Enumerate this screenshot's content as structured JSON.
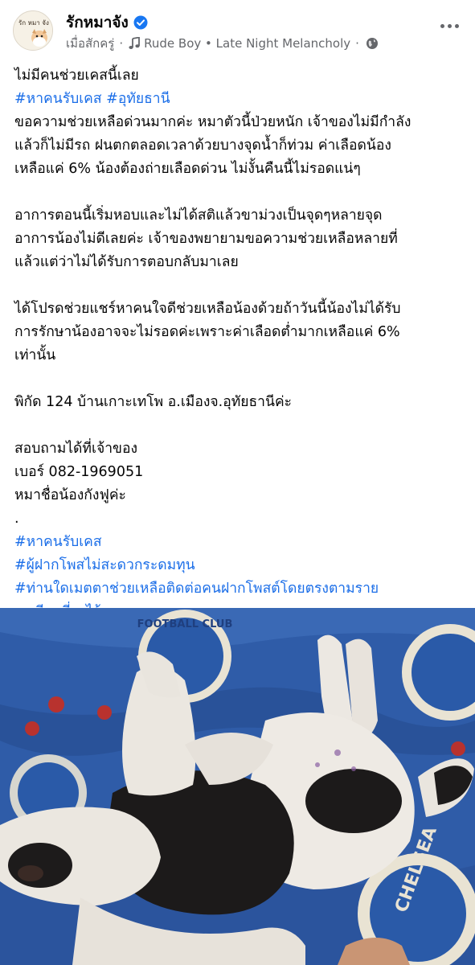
{
  "header": {
    "page_name": "รักหมาจัง",
    "timestamp": "เมื่อสักครู่",
    "music_track": "Rude Boy • Late Night Melancholy",
    "verified_icon": "verified-badge-icon",
    "music_icon": "music-note-icon",
    "audience_icon": "globe-icon",
    "more_icon": "more-options-icon",
    "avatar_text": "รัก หมา จัง"
  },
  "post": {
    "title": "ไม่มีคนช่วยเคสนี้เลย",
    "tags_top": [
      "#หาคนรับเคส",
      "#อุทัยธานี"
    ],
    "paragraph1": [
      "ขอความช่วยเหลือด่วนมากค่ะ หมาตัวนี้ป่วยหนัก เจ้าของไม่มีกำลัง",
      "แล้วก็ไม่มีรถ ฝนตกตลอดเวลาด้วยบางจุดน้ำก็ท่วม ค่าเลือดน้อง",
      "เหลือแค่ 6% น้องต้องถ่ายเลือดด่วน ไม่งั้นคืนนี้ไม่รอดแน่ๆ"
    ],
    "paragraph2": [
      "อาการตอนนี้เริ่มหอบและไม่ได้สติแล้วขาม่วงเป็นจุดๆหลายจุด",
      "อาการน้องไม่ดีเลยค่ะ เจ้าของพยายามขอความช่วยเหลือหลายที่",
      "แล้วแต่ว่าไม่ได้รับการตอบกลับมาเลย"
    ],
    "paragraph3": [
      "ได้โปรดช่วยแชร์หาคนใจดีช่วยเหลือน้องด้วยถ้าวันนี้น้องไม่ได้รับ",
      "การรักษาน้องอาจจะไม่รอดค่ะเพราะค่าเลือดต่ำมากเหลือแค่ 6%",
      "เท่านั้น"
    ],
    "location": "พิกัด 124  บ้านเกาะเทโพ อ.เมืองจ.อุทัยธานีค่ะ",
    "contact": [
      "สอบถามได้ที่เจ้าของ",
      "เบอร์ 082-1969051",
      "หมาชื่อน้องกังฟูค่ะ"
    ],
    "separator": ".",
    "tags_bottom": [
      "#หาคนรับเคส",
      "#ผู้ฝากโพสไม่สะดวกระดมทุน",
      "#ท่านใดเมตตาช่วยเหลือติดต่อคนฝากโพสต์โดยตรงตามราย",
      "ละเอียดที่ลงไว้นะคะ"
    ]
  },
  "photo": {
    "subject": "sick black-and-white dog lying on blue blanket",
    "blanket_text": "CHELSEA",
    "blanket_text_2": "FOOTBALL CLUB",
    "colors": {
      "blanket": "#2e5aa6",
      "blanket_dark": "#1f3f7f",
      "dog_white": "#ece8e2",
      "dog_black": "#1c1a1a",
      "accent_red": "#b8322e"
    }
  },
  "colors": {
    "text": "#050505",
    "meta": "#65676b",
    "hashtag": "#1b6ee8",
    "verified": "#1877f2"
  }
}
